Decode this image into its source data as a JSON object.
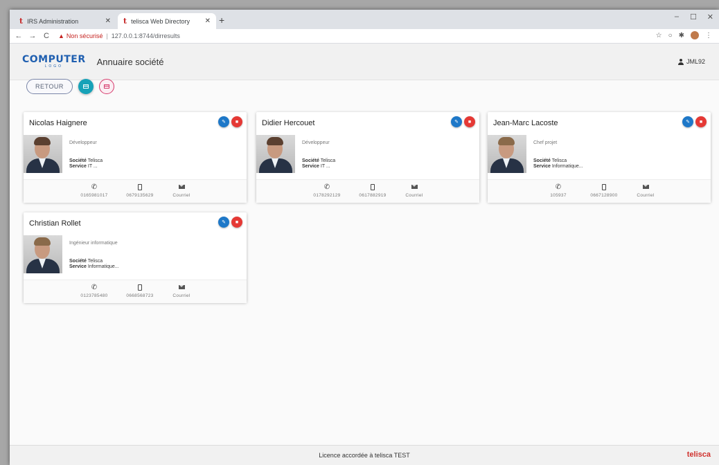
{
  "browser": {
    "tabs": [
      {
        "label": "IRS Administration",
        "favicon": "t"
      },
      {
        "label": "telisca Web Directory",
        "favicon": "t"
      }
    ],
    "new_tab": "+",
    "window_controls": [
      "–",
      "☐",
      "✕"
    ],
    "security_warning": "Non sécurisé",
    "separator": "|",
    "url": "127.0.0.1:8744/dirresults"
  },
  "header": {
    "logo_main": "COMPUTER",
    "logo_sub": "LOGO",
    "title": "Annuaire société",
    "user": "JML92"
  },
  "toolbar": {
    "back_label": "RETOUR"
  },
  "labels": {
    "company": "Société",
    "service": "Service"
  },
  "cards": [
    {
      "name": "Nicolas Haignere",
      "role": "Développeur",
      "company": "Telisca",
      "service": "IT ...",
      "phone": "0165981017",
      "mobile": "0679135629",
      "email": "Courriel"
    },
    {
      "name": "Didier Hercouet",
      "role": "Développeur",
      "company": "Telisca",
      "service": "IT ...",
      "phone": "0178292129",
      "mobile": "0617882919",
      "email": "Courriel"
    },
    {
      "name": "Jean-Marc Lacoste",
      "role": "Chef projet",
      "company": "Telisca",
      "service": "Informatique...",
      "phone": "105937",
      "mobile": "0667128900",
      "email": "Courriel"
    },
    {
      "name": "Christian Rollet",
      "role": "Ingénieur informatique",
      "company": "Telisca",
      "service": "Informatique...",
      "phone": "0123785480",
      "mobile": "0668568723",
      "email": "Courriel"
    }
  ],
  "footer": {
    "license": "Licence accordée à telisca TEST",
    "brand": "telisca"
  },
  "colors": {
    "primary_blue": "#1e78c8",
    "delete_red": "#e53935",
    "teal": "#17a2b8",
    "pink": "#d63a6c",
    "brand_red": "#d0312d",
    "logo_blue": "#1f5fb0"
  }
}
